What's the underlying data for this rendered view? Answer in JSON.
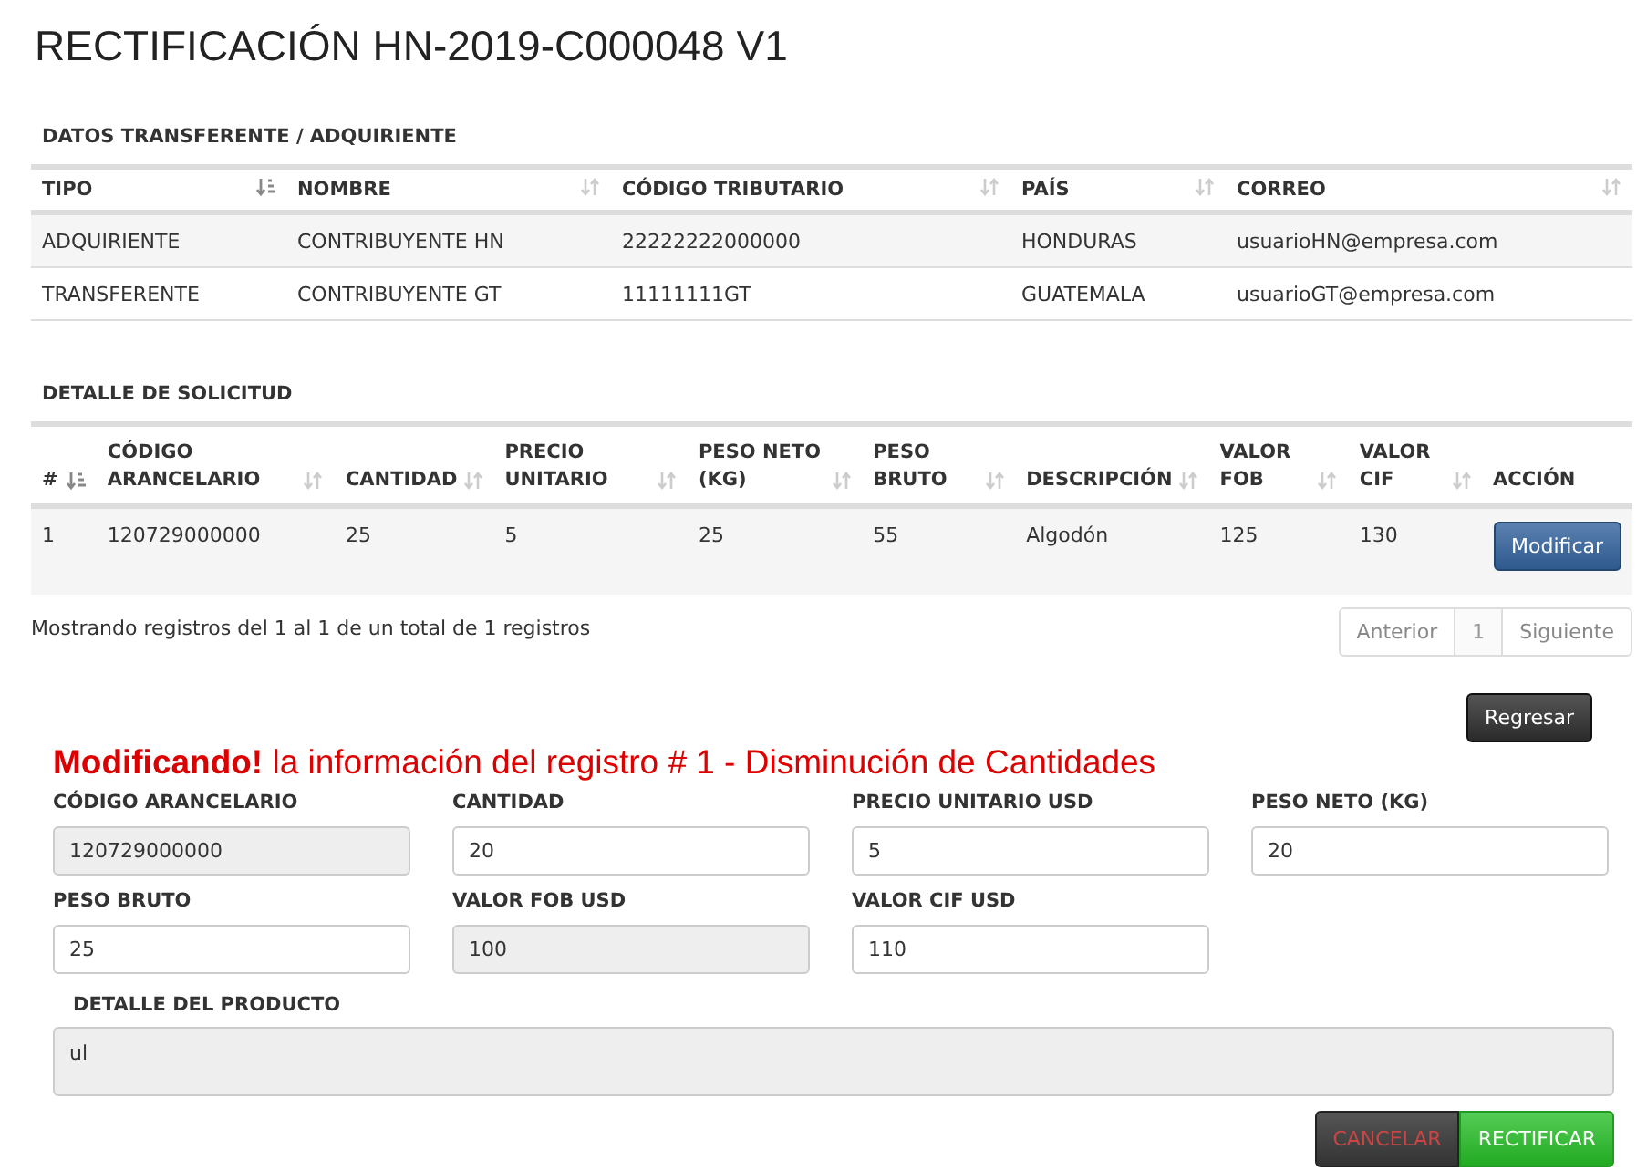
{
  "title": "RECTIFICACIÓN HN-2019-C000048 V1",
  "parties": {
    "heading": "DATOS TRANSFERENTE / ADQUIRIENTE",
    "columns": [
      {
        "label": "TIPO",
        "sorted": true
      },
      {
        "label": "NOMBRE",
        "sorted": false
      },
      {
        "label": "CÓDIGO TRIBUTARIO",
        "sorted": false
      },
      {
        "label": "PAÍS",
        "sorted": false
      },
      {
        "label": "CORREO",
        "sorted": false
      }
    ],
    "rows": [
      [
        "ADQUIRIENTE",
        "CONTRIBUYENTE HN",
        "22222222000000",
        "HONDURAS",
        "usuarioHN@empresa.com"
      ],
      [
        "TRANSFERENTE",
        "CONTRIBUYENTE GT",
        "11111111GT",
        "GUATEMALA",
        "usuarioGT@empresa.com"
      ]
    ]
  },
  "detail": {
    "heading": "DETALLE DE SOLICITUD",
    "columns": [
      {
        "label": "#",
        "sorted": true
      },
      {
        "label": "CÓDIGO ARANCELARIO",
        "sorted": false
      },
      {
        "label": "CANTIDAD",
        "sorted": false
      },
      {
        "label": "PRECIO UNITARIO",
        "sorted": false
      },
      {
        "label": "PESO NETO (KG)",
        "sorted": false
      },
      {
        "label": "PESO BRUTO",
        "sorted": false
      },
      {
        "label": "DESCRIPCIÓN",
        "sorted": false
      },
      {
        "label": "VALOR FOB",
        "sorted": false
      },
      {
        "label": "VALOR CIF",
        "sorted": false
      },
      {
        "label": "ACCIÓN"
      }
    ],
    "rows": [
      {
        "cells": [
          "1",
          "120729000000",
          "25",
          "5",
          "25",
          "55",
          "Algodón",
          "125",
          "130"
        ],
        "action": "Modificar"
      }
    ],
    "info": "Mostrando registros del 1 al 1 de un total de 1 registros",
    "pagination": [
      {
        "label": "Anterior",
        "selected": false
      },
      {
        "label": "1",
        "selected": true
      },
      {
        "label": "Siguiente",
        "selected": false
      }
    ]
  },
  "back_button": "Regresar",
  "edit_heading": "**Modificando!** la información del registro # 1 - Disminución de Cantidades",
  "fields": [
    {
      "label": "CÓDIGO ARANCELARIO",
      "value": "120729000000",
      "disabled": true
    },
    {
      "label": "CANTIDAD",
      "value": "20",
      "disabled": false
    },
    {
      "label": "PRECIO UNITARIO USD",
      "value": "5",
      "disabled": false
    },
    {
      "label": "PESO NETO (KG)",
      "value": "20",
      "disabled": false
    },
    {
      "label": "PESO BRUTO",
      "value": "25",
      "disabled": false
    },
    {
      "label": "VALOR FOB USD",
      "value": "100",
      "disabled": true
    },
    {
      "label": "VALOR CIF USD",
      "value": "110",
      "disabled": false
    }
  ],
  "product_detail": {
    "label": "DETALLE DEL PRODUCTO",
    "value": "ul",
    "disabled": true
  },
  "buttons": [
    {
      "label": "CANCELAR",
      "kind": "cancel"
    },
    {
      "label": "RECTIFICAR",
      "kind": "confirm"
    }
  ]
}
